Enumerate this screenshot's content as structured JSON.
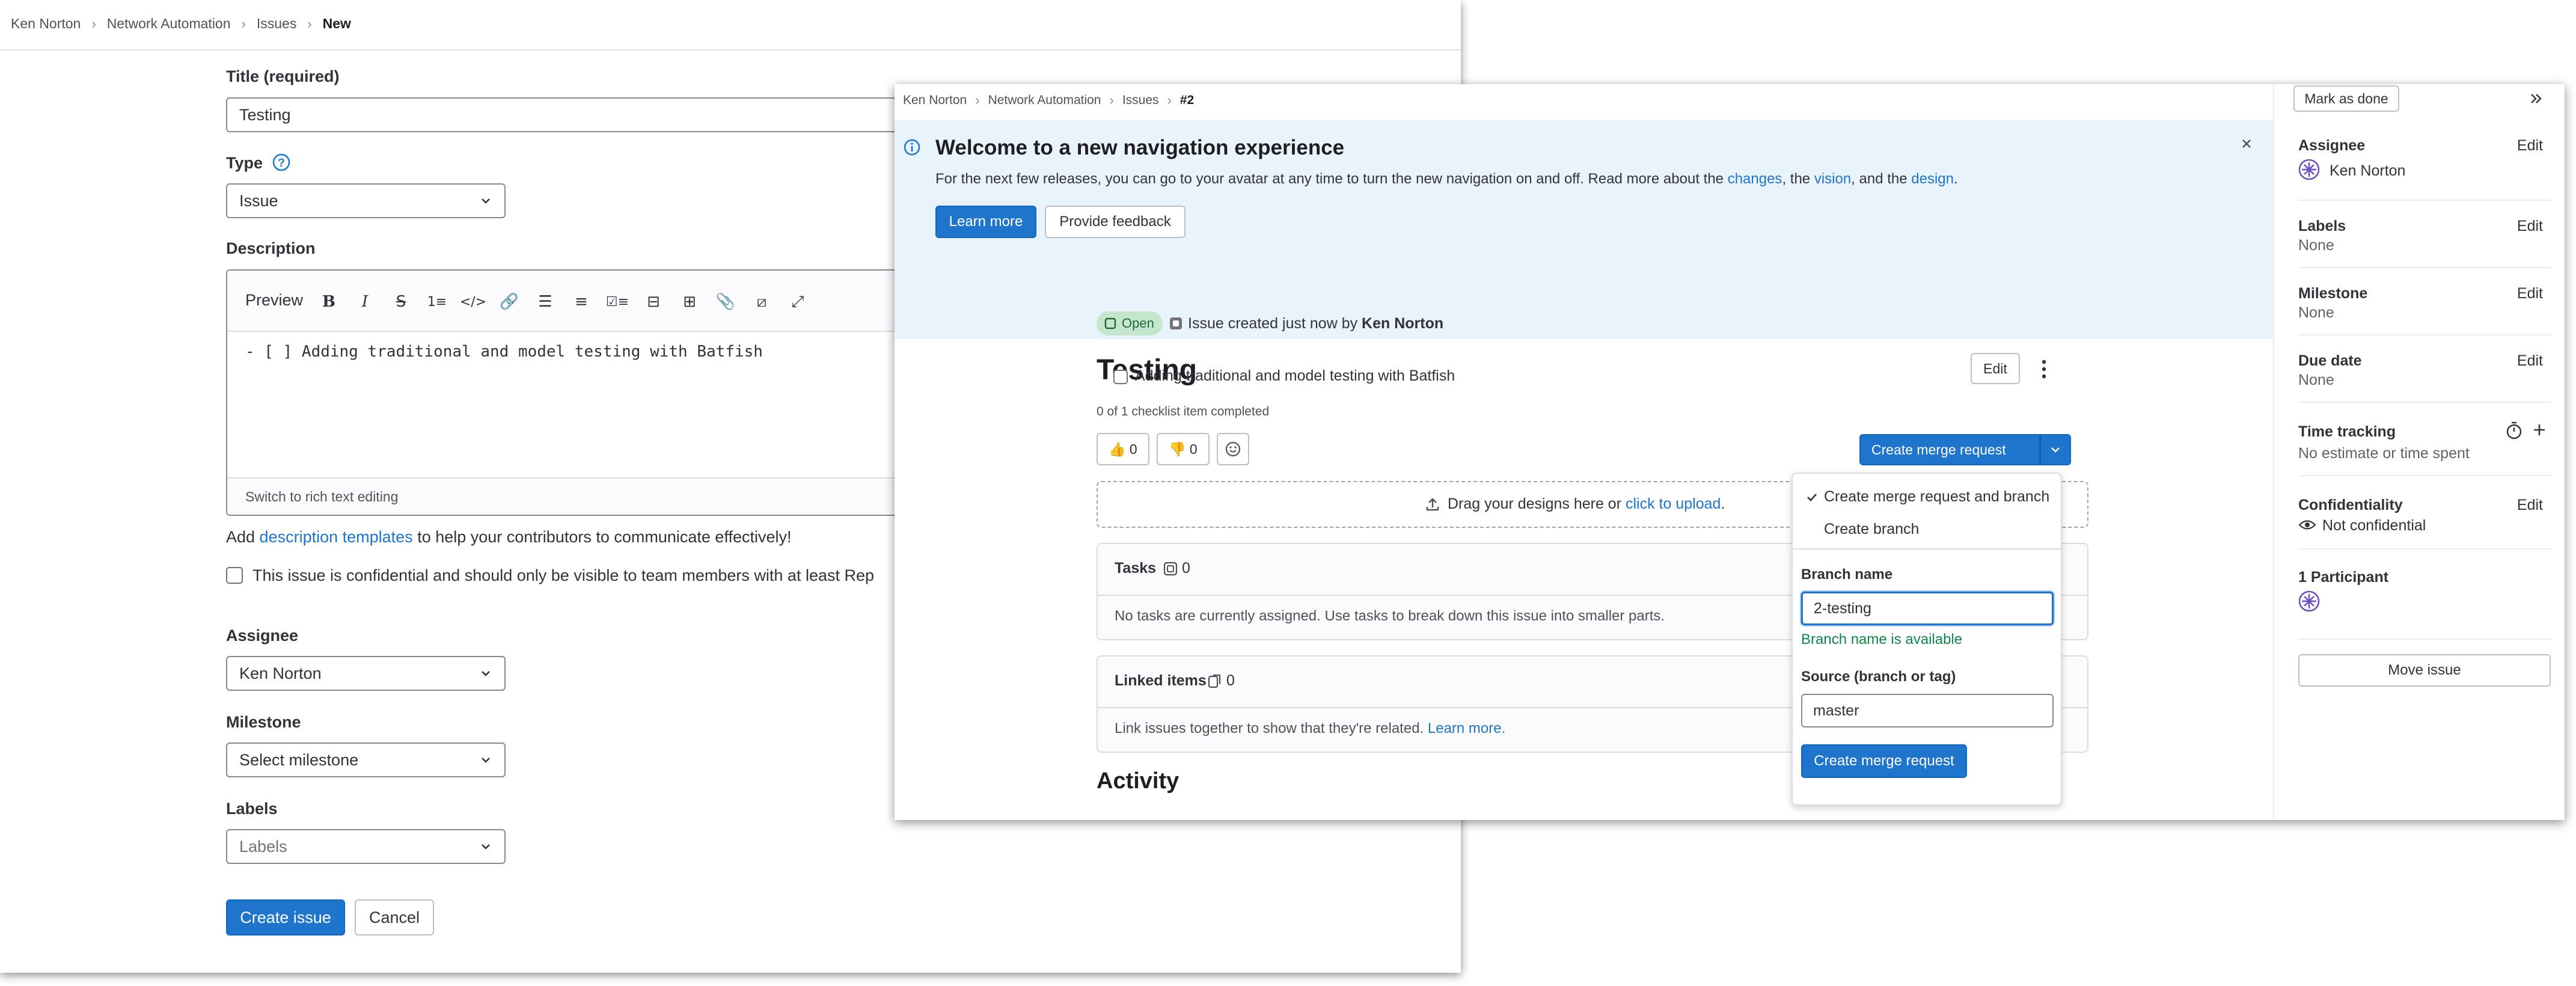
{
  "left_window": {
    "breadcrumb": [
      "Ken Norton",
      "Network Automation",
      "Issues",
      "New"
    ],
    "title_label": "Title (required)",
    "title_value": "Testing",
    "type_label": "Type",
    "type_value": "Issue",
    "description_label": "Description",
    "editor": {
      "preview_tab": "Preview",
      "content": "- [ ] Adding traditional and model testing with Batfish",
      "switch_label": "Switch to rich text editing"
    },
    "templates_hint": {
      "prefix": "Add ",
      "link": "description templates",
      "suffix": " to help your contributors to communicate effectively!"
    },
    "confidential_label": "This issue is confidential and should only be visible to team members with at least Rep",
    "assignee_label": "Assignee",
    "assignee_value": "Ken Norton",
    "milestone_label": "Milestone",
    "milestone_value": "Select milestone",
    "labels_label": "Labels",
    "labels_value": "Labels",
    "create_button": "Create issue",
    "cancel_button": "Cancel"
  },
  "right_window": {
    "breadcrumb": [
      "Ken Norton",
      "Network Automation",
      "Issues",
      "#2"
    ],
    "banner": {
      "title": "Welcome to a new navigation experience",
      "text_prefix": "For the next few releases, you can go to your avatar at any time to turn the new navigation on and off. Read more about the ",
      "link_changes": "changes",
      "sep1": ", the ",
      "link_vision": "vision",
      "sep2": ", and the ",
      "link_design": "design",
      "end": ".",
      "learn_more": "Learn more",
      "feedback": "Provide feedback"
    },
    "issue": {
      "title": "Testing",
      "edit_button": "Edit",
      "status": "Open",
      "created_prefix": "Issue created just now by ",
      "author": "Ken Norton",
      "task_item": "Adding traditional and model testing with Batfish",
      "checklist_progress": "0 of 1 checklist item completed",
      "thumbs_up": "0",
      "thumbs_down": "0",
      "create_mr_button": "Create merge request",
      "designs_prefix": "Drag your designs here or ",
      "designs_link": "click to upload",
      "designs_end": ".",
      "tasks_title": "Tasks",
      "tasks_count": "0",
      "tasks_empty": "No tasks are currently assigned. Use tasks to break down this issue into smaller parts.",
      "linked_title": "Linked items",
      "linked_count": "0",
      "linked_text": "Link issues together to show that they're related. ",
      "linked_link": "Learn more.",
      "activity_title": "Activity"
    },
    "mr_dropdown": {
      "option_selected": "Create merge request and branch",
      "option_branch": "Create branch",
      "branch_label": "Branch name",
      "branch_value": "2-testing",
      "branch_status": "Branch name is available",
      "source_label": "Source (branch or tag)",
      "source_value": "master",
      "submit": "Create merge request"
    },
    "sidebar": {
      "mark_done": "Mark as done",
      "assignee_label": "Assignee",
      "assignee_value": "Ken Norton",
      "labels_label": "Labels",
      "labels_value": "None",
      "milestone_label": "Milestone",
      "milestone_value": "None",
      "due_label": "Due date",
      "due_value": "None",
      "time_label": "Time tracking",
      "time_value": "No estimate or time spent",
      "confidentiality_label": "Confidentiality",
      "confidentiality_value": "Not confidential",
      "participants_label": "1 Participant",
      "move_issue": "Move issue",
      "edit": "Edit"
    }
  },
  "colors": {
    "primary": "#1f75cb",
    "banner_bg": "#e9f3fc",
    "success_text": "#108548",
    "open_badge_bg": "#c3e6cd",
    "open_badge_text": "#24663b"
  }
}
